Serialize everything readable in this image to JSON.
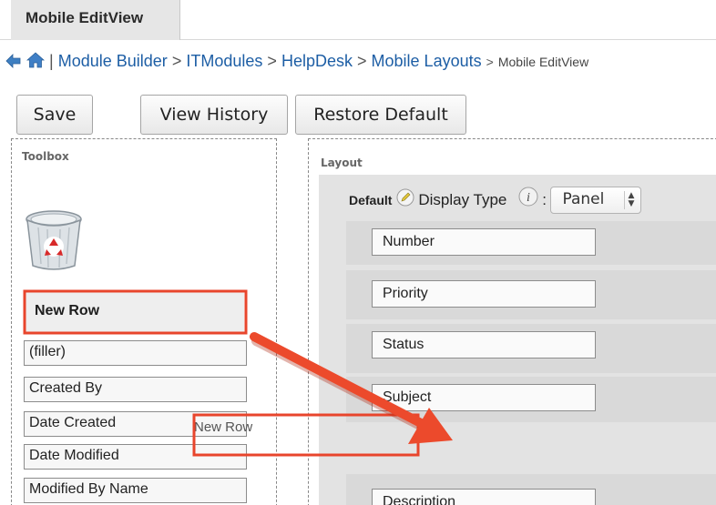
{
  "tab": {
    "label": "Mobile EditView"
  },
  "breadcrumb": {
    "separator": "|",
    "arrow": ">",
    "items": [
      "Module Builder",
      "ITModules",
      "HelpDesk",
      "Mobile Layouts"
    ],
    "current": "Mobile EditView"
  },
  "buttons": {
    "save": "Save",
    "view_history": "View History",
    "restore_default": "Restore Default"
  },
  "toolbox": {
    "title": "Toolbox",
    "new_row": "New Row",
    "fields": [
      "(filler)",
      "Created By",
      "Date Created",
      "Date Modified",
      "Modified By Name"
    ]
  },
  "layout": {
    "title": "Layout",
    "panel_name": "Default",
    "display_type_label": "Display Type",
    "display_type_colon": ":",
    "display_type_value": "Panel",
    "fields": [
      "Number",
      "Priority",
      "Status",
      "Subject",
      "Description"
    ]
  },
  "drag": {
    "label": "New Row"
  },
  "icons": {
    "back": "back-arrow-icon",
    "home": "home-icon",
    "edit": "pencil-icon",
    "info": "info-icon",
    "trash": "recycle-bin-icon"
  },
  "colors": {
    "highlight": "#e8452c",
    "link": "#1d5ea5"
  }
}
